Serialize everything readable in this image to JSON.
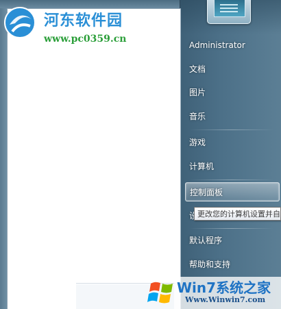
{
  "watermark_top": {
    "title": "河东软件园",
    "url": "www.pc0359.cn"
  },
  "menu": {
    "items": [
      {
        "label": "Administrator"
      },
      {
        "label": "文档"
      },
      {
        "label": "图片"
      },
      {
        "label": "音乐"
      },
      {
        "label": "游戏"
      },
      {
        "label": "计算机"
      },
      {
        "label": "控制面板"
      },
      {
        "label": "设"
      },
      {
        "label": "默认程序"
      },
      {
        "label": "帮助和支持"
      }
    ],
    "highlighted_index": 6
  },
  "tooltip": {
    "text": "更改您的计算机设置并自"
  },
  "watermark_bottom": {
    "brand": "Win7系统之家",
    "url": "Www.Winwin7.com"
  },
  "colors": {
    "right_panel": "#4c7088",
    "left_pane": "#ffffff",
    "menu_text": "#ffffff",
    "watermark_blue": "#2a8fd6",
    "watermark_green": "#2c9f3a"
  }
}
